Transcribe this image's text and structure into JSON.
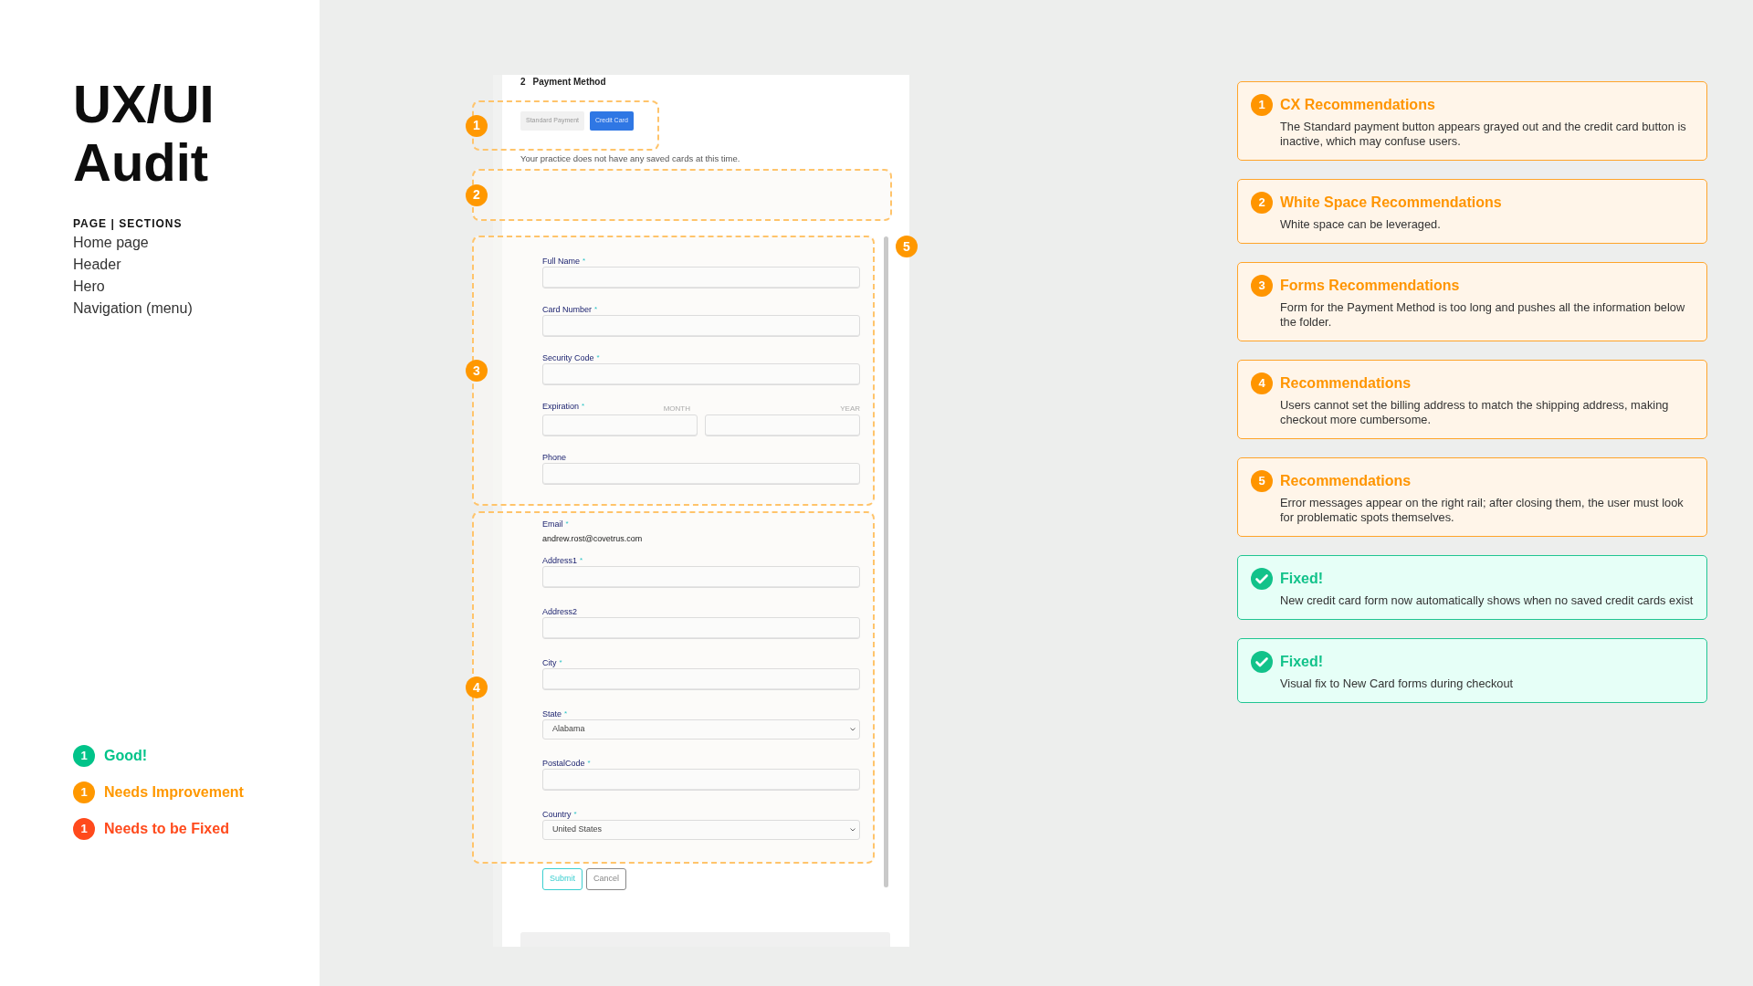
{
  "sidebar": {
    "title_lines": [
      "UX/UI",
      "Audit"
    ],
    "section_heading": "PAGE | SECTIONS",
    "sections": [
      "Home page",
      "Header",
      "Hero",
      "Navigation (menu)"
    ],
    "legend": [
      {
        "count": "1",
        "label": "Good!",
        "color": "#00c389"
      },
      {
        "count": "1",
        "label": "Needs Improvement",
        "color": "#ff9800"
      },
      {
        "count": "1",
        "label": "Needs to be Fixed",
        "color": "#ff4a1c"
      }
    ]
  },
  "mockup": {
    "step_number": "2",
    "step_title": "Payment Method",
    "payment_options": [
      {
        "label": "Standard Payment",
        "selected": false
      },
      {
        "label": "Credit Card",
        "selected": true
      }
    ],
    "notice": "Your practice does not have any saved cards at this time.",
    "card_fields": [
      {
        "kind": "input",
        "label": "Full Name",
        "required_mark": "*"
      },
      {
        "kind": "input",
        "label": "Card Number",
        "required_mark": "*"
      },
      {
        "kind": "input",
        "label": "Security Code",
        "required_mark": "*"
      },
      {
        "kind": "split",
        "label": "Expiration",
        "required_mark": "*",
        "sublabels": [
          "MONTH",
          "YEAR"
        ]
      },
      {
        "kind": "input",
        "label": "Phone"
      }
    ],
    "contact_fields": [
      {
        "kind": "text",
        "label": "Email",
        "required_mark": "*",
        "value": "andrew.rost@covetrus.com"
      },
      {
        "kind": "input",
        "label": "Address1",
        "required_mark": "*"
      },
      {
        "kind": "input",
        "label": "Address2"
      },
      {
        "kind": "input",
        "label": "City",
        "required_mark": "*"
      },
      {
        "kind": "select",
        "label": "State",
        "required_mark": "*",
        "value": "Alabama"
      },
      {
        "kind": "input",
        "label": "PostalCode",
        "required_mark": "*"
      },
      {
        "kind": "select",
        "label": "Country",
        "required_mark": "*",
        "value": "United States"
      }
    ],
    "buttons": [
      {
        "kind": "primary",
        "label": "Submit"
      },
      {
        "kind": "secondary",
        "label": "Cancel"
      }
    ],
    "markers": [
      "1",
      "2",
      "3",
      "4",
      "5"
    ]
  },
  "cards": [
    {
      "kind": "numbered",
      "number": "1",
      "title": "CX Recommendations",
      "text": "The Standard payment button appears grayed out and the credit card button is inactive, which may confuse users."
    },
    {
      "kind": "numbered",
      "number": "2",
      "title": "White Space Recommendations",
      "text": "White space can be leveraged."
    },
    {
      "kind": "numbered",
      "number": "3",
      "title": "Forms Recommendations",
      "text": "Form for the Payment Method is too long and pushes all the information below the folder."
    },
    {
      "kind": "numbered",
      "number": "4",
      "title": "Recommendations",
      "text": "Users cannot set the billing address to match the shipping address, making checkout more cumbersome."
    },
    {
      "kind": "numbered",
      "number": "5",
      "title": "Recommendations",
      "text": "Error messages appear on the right rail; after closing them, the user must look for problematic spots themselves."
    },
    {
      "kind": "fixed",
      "title": "Fixed!",
      "text": "New credit card form now automatically shows when no saved credit cards exist"
    },
    {
      "kind": "fixed",
      "title": "Fixed!",
      "text": "Visual fix to New Card forms during checkout"
    }
  ]
}
